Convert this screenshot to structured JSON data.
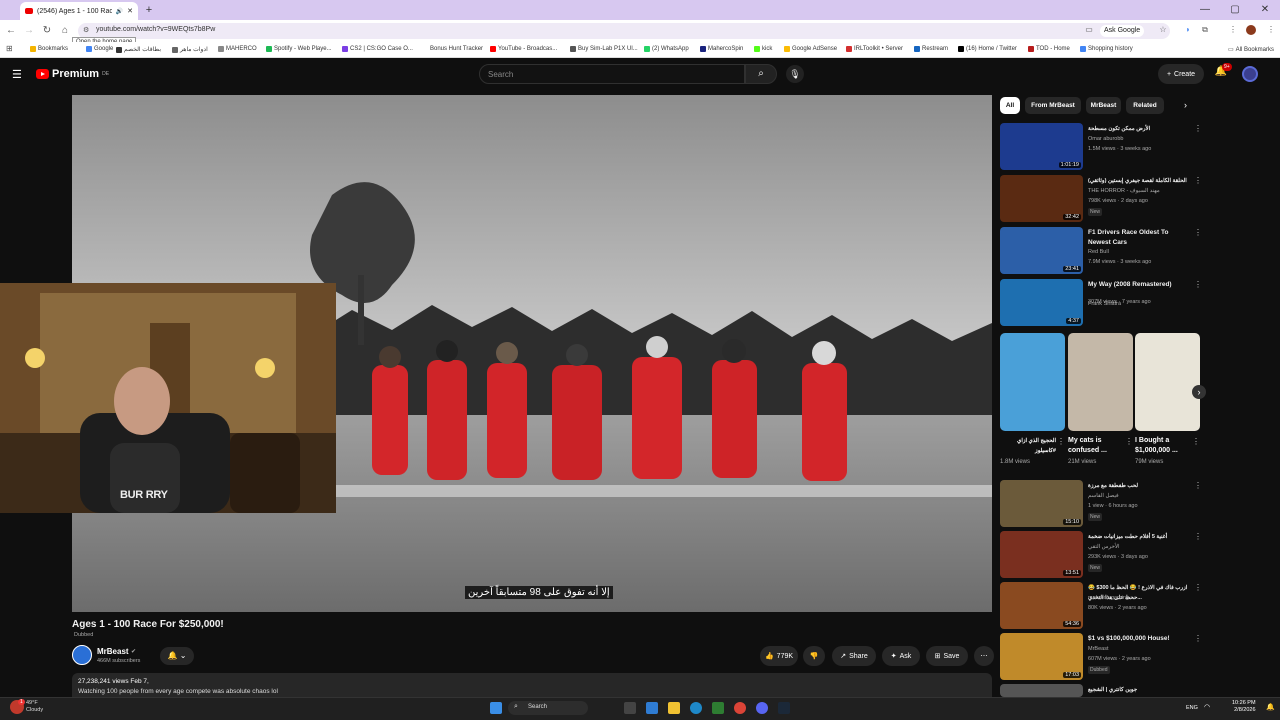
{
  "browser": {
    "tab_title": "(2546) Ages 1 - 100 Race F...",
    "url": "youtube.com/watch?v=9WEQts7b8Pw",
    "ask_google": "Ask Google",
    "tooltip": "Open the home page",
    "all_bookmarks": "All Bookmarks",
    "bookmarks": [
      {
        "label": "Bookmarks",
        "color": "#f4b400"
      },
      {
        "label": "Google",
        "color": "#4285f4"
      },
      {
        "label": "بطاقات الخصم",
        "color": "#333333"
      },
      {
        "label": "ادوات ماهر",
        "color": "#666666"
      },
      {
        "label": "MAHERCO",
        "color": "#888888"
      },
      {
        "label": "Spotify - Web Playe...",
        "color": "#1db954"
      },
      {
        "label": "CS2 | CS:GO Case O...",
        "color": "#7b3fe4"
      },
      {
        "label": "Bonus Hunt Tracker",
        "color": "#ffffff"
      },
      {
        "label": "YouTube - Broadcas...",
        "color": "#ff0000"
      },
      {
        "label": "Buy Sim-Lab P1X Ul...",
        "color": "#555555"
      },
      {
        "label": "(2) WhatsApp",
        "color": "#25d366"
      },
      {
        "label": "MahercoSpin",
        "color": "#1a237e"
      },
      {
        "label": "kick",
        "color": "#53fc18"
      },
      {
        "label": "Google AdSense",
        "color": "#fbbc05"
      },
      {
        "label": "IRLToolkit • Server",
        "color": "#d32f2f"
      },
      {
        "label": "Restream",
        "color": "#1565c0"
      },
      {
        "label": "(16) Home / Twitter",
        "color": "#000000"
      },
      {
        "label": "TOD - Home",
        "color": "#b71c1c"
      },
      {
        "label": "Shopping history",
        "color": "#4285f4"
      }
    ]
  },
  "youtube": {
    "logo_text": "Premium",
    "logo_region": "DE",
    "search_placeholder": "Search",
    "create_label": "Create",
    "notif_badge": "9+"
  },
  "video": {
    "subtitle": "إلا أنه تفوق على 98 متسابقاً آخرين",
    "webcam_text": "BUR   RRY",
    "title": "Ages 1 - 100 Race For $250,000!",
    "dubbed": "Dubbed",
    "channel": "MrBeast",
    "subscribers": "466M subscribers",
    "likes": "779K",
    "share": "Share",
    "ask": "Ask",
    "save": "Save",
    "desc_stats": "27,238,241 views  Feb 7,",
    "desc_text": "Watching 100 people from every age compete was absolute chaos lol"
  },
  "chips": [
    "All",
    "From MrBeast",
    "MrBeast",
    "Related"
  ],
  "recommendations": [
    {
      "title": "الأرض ممكن تكون مسطحة",
      "channel": "Omar aburobb",
      "meta": "1.5M views · 3 weeks ago",
      "duration": "1:01:19",
      "new": "",
      "color": "#1d3b8f"
    },
    {
      "title": "الحلقة الكاملة لقصة جيفري إبستين (وثائقي)",
      "channel": "THE HORROR - مهند السيوف",
      "meta": "798K views · 2 days ago",
      "duration": "32:42",
      "new": "New",
      "color": "#5a2a12"
    },
    {
      "title": "F1 Drivers Race Oldest To Newest Cars",
      "channel": "Red Bull",
      "meta": "7.9M views · 3 weeks ago",
      "duration": "23:41",
      "new": "",
      "color": "#2c5fa8"
    },
    {
      "title": "My Way (2008 Remastered)",
      "channel": "Frank Sinatra",
      "meta": "307M views · 7 years ago",
      "duration": "4:37",
      "new": "",
      "color": "#1e6fb0"
    },
    {
      "title": "لحب طفطفة مع مرزة",
      "channel": "فيصل القاسم",
      "meta": "1 view · 6 hours ago",
      "duration": "15:10",
      "new": "New",
      "color": "#6b5a3a"
    },
    {
      "title": "أغنية 5 أفلام حطت ميزانيات ضخمة",
      "channel": "الأخرس التقي",
      "meta": "293K views · 3 days ago",
      "duration": "13:51",
      "new": "New",
      "color": "#7a2f1f"
    },
    {
      "title": "ازرب فاك في الاذرع ! 😂 الحظ ما 300$ 😂 ...ححظ على هذا التحدي",
      "channel": "maherco gaming",
      "meta": "80K views · 2 years ago",
      "duration": "54:36",
      "new": "",
      "color": "#8a4a20"
    },
    {
      "title": "$1 vs $100,000,000 House!",
      "channel": "MrBeast",
      "meta": "607M views · 2 years ago",
      "duration": "17:03",
      "new": "Dubbed",
      "color": "#c08a2a"
    },
    {
      "title": "جوين كانتري | الشجيع",
      "channel": "",
      "meta": "",
      "duration": "",
      "new": "",
      "color": "#555555"
    }
  ],
  "shorts": [
    {
      "title": "الحجيج الذي ازاي #كاسيلوز",
      "views": "1.8M views",
      "color": "#4aa0d8"
    },
    {
      "title": "My cats is confused ...",
      "views": "21M views",
      "color": "#c4b8a8"
    },
    {
      "title": "I Bought a $1,000,000 ...",
      "views": "79M views",
      "color": "#e8e4d8"
    }
  ],
  "taskbar": {
    "temp": "49°F",
    "weather": "Cloudy",
    "search": "Search",
    "lang": "ENG",
    "time": "10:26 PM",
    "date": "2/8/2026",
    "notif_count": "1"
  }
}
